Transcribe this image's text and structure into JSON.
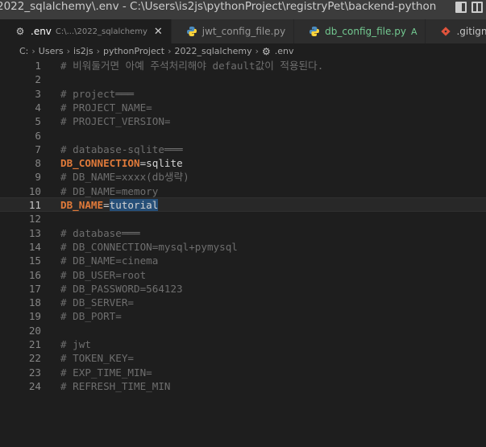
{
  "window": {
    "title": "2022_sqlalchemy\\.env - C:\\Users\\is2js\\pythonProject\\registryPet\\backend-python"
  },
  "tabs": [
    {
      "label": ".env",
      "desc": "C:\\...\\2022_sqlalchemy",
      "icon": "gear-icon",
      "close": "✕"
    },
    {
      "label": "jwt_config_file.py",
      "icon": "python-icon"
    },
    {
      "label": "db_config_file.py",
      "icon": "python-icon",
      "badge": "A"
    },
    {
      "label": ".gitignore",
      "icon": "git-icon"
    }
  ],
  "breadcrumb": [
    "C:",
    "Users",
    "is2js",
    "pythonProject",
    "2022_sqlalchemy",
    ".env"
  ],
  "editor": {
    "active_line": "11",
    "lines": [
      {
        "n": "1",
        "t": "# 비워둘거면 아예 주석처리해야 default값이 적용된다."
      },
      {
        "n": "2",
        "t": ""
      },
      {
        "n": "3",
        "t": "# project═══"
      },
      {
        "n": "4",
        "t": "# PROJECT_NAME="
      },
      {
        "n": "5",
        "t": "# PROJECT_VERSION="
      },
      {
        "n": "6",
        "t": ""
      },
      {
        "n": "7",
        "t": "# database-sqlite═══"
      },
      {
        "n": "8",
        "k": "DB_CONNECTION",
        "v": "sqlite"
      },
      {
        "n": "9",
        "t": "# DB_NAME=xxxx(db생략)"
      },
      {
        "n": "10",
        "t": "# DB_NAME=memory"
      },
      {
        "n": "11",
        "k": "DB_NAME",
        "v": "tutorial"
      },
      {
        "n": "12",
        "t": ""
      },
      {
        "n": "13",
        "t": "# database═══"
      },
      {
        "n": "14",
        "t": "# DB_CONNECTION=mysql+pymysql"
      },
      {
        "n": "15",
        "t": "# DB_NAME=cinema"
      },
      {
        "n": "16",
        "t": "# DB_USER=root"
      },
      {
        "n": "17",
        "t": "# DB_PASSWORD=564123"
      },
      {
        "n": "18",
        "t": "# DB_SERVER= "
      },
      {
        "n": "19",
        "t": "# DB_PORT="
      },
      {
        "n": "20",
        "t": ""
      },
      {
        "n": "21",
        "t": "# jwt"
      },
      {
        "n": "22",
        "t": "# TOKEN_KEY="
      },
      {
        "n": "23",
        "t": "# EXP_TIME_MIN="
      },
      {
        "n": "24",
        "t": "# REFRESH_TIME_MIN"
      }
    ]
  },
  "colors": {
    "key": "#e07a3a",
    "comment": "#7c7c7c",
    "selection": "#264f78"
  }
}
